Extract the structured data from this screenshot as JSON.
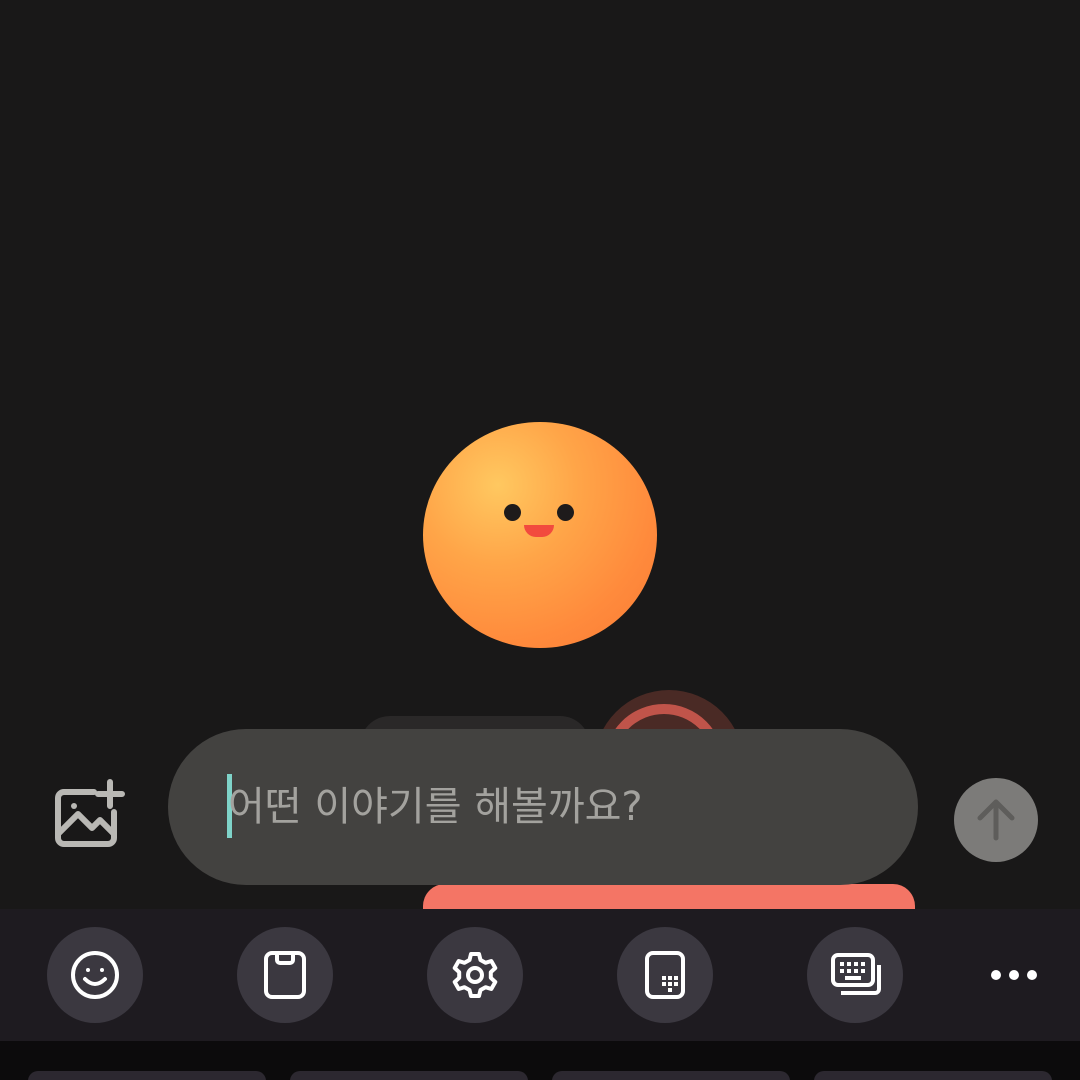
{
  "input": {
    "placeholder": "어떤 이야기를 해볼까요?"
  },
  "icons": {
    "image_add": "image-add-icon",
    "send": "arrow-up-icon",
    "toolbar": [
      "emoji-icon",
      "clipboard-icon",
      "settings-icon",
      "keypad-mode-icon",
      "keyboard-layout-icon",
      "more-icon"
    ]
  },
  "colors": {
    "accent_coral": "#f47565",
    "mascot_orange": "#ff9440",
    "caret": "#7fd3c9"
  }
}
